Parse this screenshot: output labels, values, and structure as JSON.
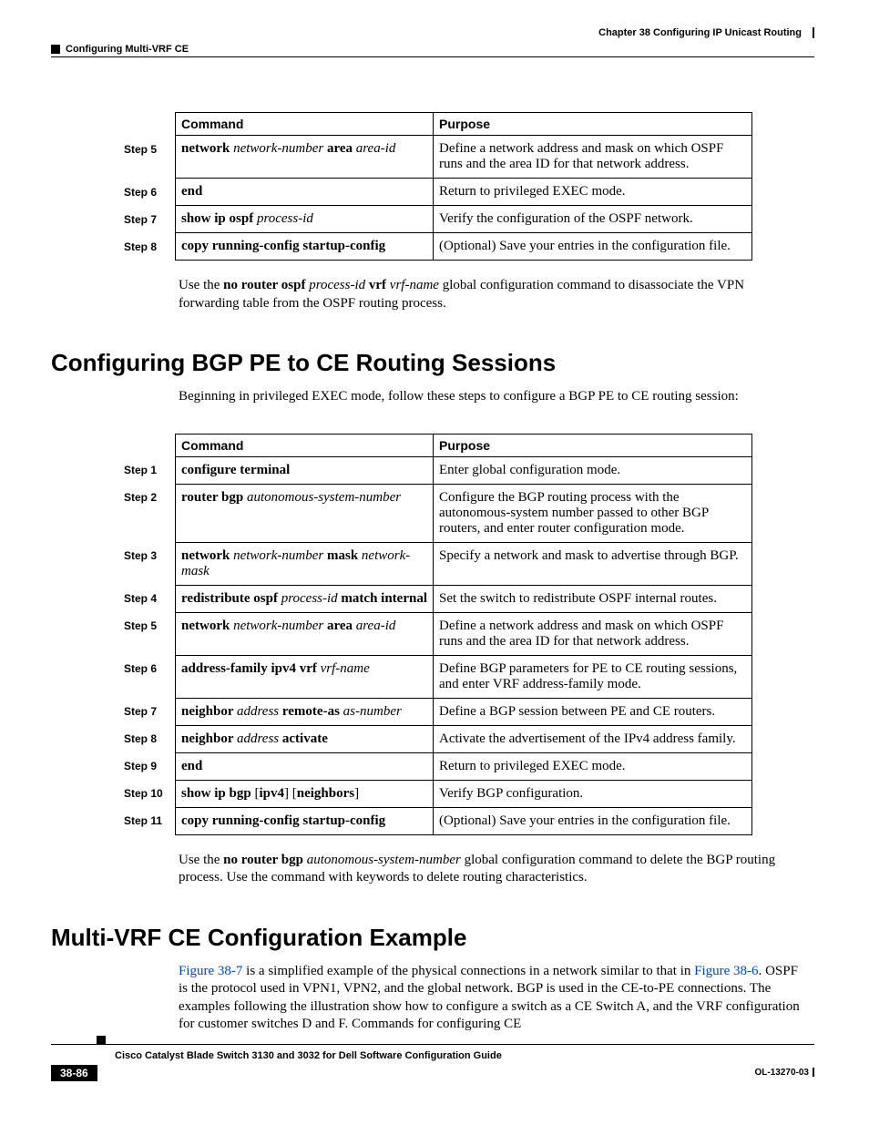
{
  "header": {
    "chapter": "Chapter 38    Configuring IP Unicast Routing",
    "section": "Configuring Multi-VRF CE"
  },
  "table1": {
    "head_cmd": "Command",
    "head_purpose": "Purpose",
    "rows": [
      {
        "step": "Step 5",
        "cmd_b1": "network ",
        "cmd_i1": "network-number ",
        "cmd_b2": "area ",
        "cmd_i2": "area-id",
        "purpose": "Define a network address and mask on which OSPF runs and the area ID for that network address."
      },
      {
        "step": "Step 6",
        "cmd_b1": "end",
        "cmd_i1": "",
        "cmd_b2": "",
        "cmd_i2": "",
        "purpose": "Return to privileged EXEC mode."
      },
      {
        "step": "Step 7",
        "cmd_b1": "show ip ospf ",
        "cmd_i1": "process-id",
        "cmd_b2": "",
        "cmd_i2": "",
        "purpose": "Verify the configuration of the OSPF network."
      },
      {
        "step": "Step 8",
        "cmd_b1": "copy running-config startup-config",
        "cmd_i1": "",
        "cmd_b2": "",
        "cmd_i2": "",
        "purpose": "(Optional) Save your entries in the configuration file."
      }
    ]
  },
  "para1": {
    "p1": "Use the ",
    "b1": "no router ospf ",
    "i1": "process-id ",
    "b2": "vrf ",
    "i2": "vrf-name ",
    "p2": "global configuration command to disassociate the VPN forwarding table from the OSPF routing process."
  },
  "h2a": "Configuring BGP PE to CE Routing Sessions",
  "intro2": "Beginning in privileged EXEC mode, follow these steps to configure a BGP PE to CE routing session:",
  "table2": {
    "head_cmd": "Command",
    "head_purpose": "Purpose",
    "rows": [
      {
        "step": "Step 1",
        "cmd": [
          {
            "b": "configure terminal"
          }
        ],
        "purpose": "Enter global configuration mode."
      },
      {
        "step": "Step 2",
        "cmd": [
          {
            "b": "router bgp "
          },
          {
            "i": "autonomous-system-number"
          }
        ],
        "purpose": "Configure the BGP routing process with the autonomous-system number passed to other BGP routers, and enter router configuration mode."
      },
      {
        "step": "Step 3",
        "cmd": [
          {
            "b": "network "
          },
          {
            "i": "network-number "
          },
          {
            "b": "mask "
          },
          {
            "i": "network-mask"
          }
        ],
        "purpose": "Specify a network and mask to advertise through BGP."
      },
      {
        "step": "Step 4",
        "cmd": [
          {
            "b": "redistribute ospf "
          },
          {
            "i": "process-id "
          },
          {
            "b": "match internal"
          }
        ],
        "purpose": "Set the switch to redistribute OSPF internal routes."
      },
      {
        "step": "Step 5",
        "cmd": [
          {
            "b": "network "
          },
          {
            "i": "network-number "
          },
          {
            "b": "area "
          },
          {
            "i": "area-id"
          }
        ],
        "purpose": "Define a network address and mask on which OSPF runs and the area ID for that network address."
      },
      {
        "step": "Step 6",
        "cmd": [
          {
            "b": "address-family ipv4 vrf "
          },
          {
            "i": "vrf-name"
          }
        ],
        "purpose": "Define BGP parameters for PE to CE routing sessions, and enter VRF address-family mode."
      },
      {
        "step": "Step 7",
        "cmd": [
          {
            "b": "neighbor "
          },
          {
            "i": "address "
          },
          {
            "b": "remote-as "
          },
          {
            "i": "as-number"
          }
        ],
        "purpose": "Define a BGP session between PE and CE routers."
      },
      {
        "step": "Step 8",
        "cmd": [
          {
            "b": "neighbor "
          },
          {
            "i": "address "
          },
          {
            "b": "activate"
          }
        ],
        "purpose": "Activate the advertisement of the IPv4 address family."
      },
      {
        "step": "Step 9",
        "cmd": [
          {
            "b": "end"
          }
        ],
        "purpose": "Return to privileged EXEC mode."
      },
      {
        "step": "Step 10",
        "cmd": [
          {
            "b": "show ip bgp "
          },
          {
            "n": "["
          },
          {
            "b": "ipv4"
          },
          {
            "n": "] ["
          },
          {
            "b": "neighbors"
          },
          {
            "n": "]"
          }
        ],
        "purpose": "Verify BGP configuration."
      },
      {
        "step": "Step 11",
        "cmd": [
          {
            "b": "copy running-config startup-config"
          }
        ],
        "purpose": "(Optional) Save your entries in the configuration file."
      }
    ]
  },
  "para2": {
    "p1": "Use the ",
    "b1": "no router bgp ",
    "i1": "autonomous-system-number ",
    "p2": "global configuration command to delete the BGP routing process. Use the command with keywords to delete routing characteristics."
  },
  "h2b": "Multi-VRF CE Configuration Example",
  "para3": {
    "l1": "Figure 38-7",
    "p1": " is a simplified example of the physical connections in a network similar to that in ",
    "l2": "Figure 38-6",
    "p2": ". OSPF is the protocol used in VPN1, VPN2, and the global network. BGP is used in the CE-to-PE connections. The examples following the illustration show how to configure a switch as a CE Switch A, and the VRF configuration for customer switches D and F. Commands for configuring CE"
  },
  "footer": {
    "title": "Cisco Catalyst Blade Switch 3130 and 3032 for Dell Software Configuration Guide",
    "page": "38-86",
    "docid": "OL-13270-03"
  }
}
